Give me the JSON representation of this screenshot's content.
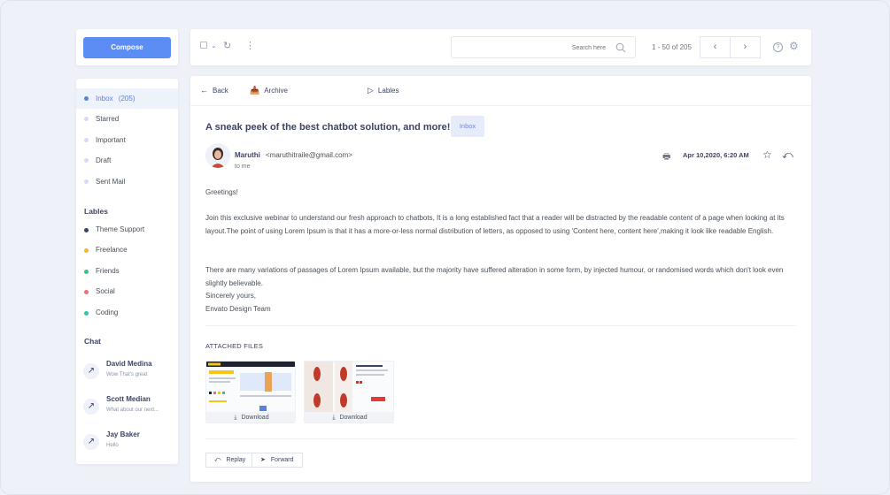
{
  "sidebar": {
    "compose_label": "Compose",
    "folders": [
      {
        "label": "Inbox",
        "count": "(205)",
        "color": "#5c7fd9"
      },
      {
        "label": "Starred",
        "color": "#d4dcf4"
      },
      {
        "label": "Important",
        "color": "#d4dcf4"
      },
      {
        "label": "Draft",
        "color": "#d4dcf4"
      },
      {
        "label": "Sent Mail",
        "color": "#d4dcf4"
      }
    ],
    "labels_title": "Lables",
    "labels": [
      {
        "label": "Theme Support",
        "color": "#3d4465"
      },
      {
        "label": "Freelance",
        "color": "#f5b724"
      },
      {
        "label": "Friends",
        "color": "#37c387"
      },
      {
        "label": "Social",
        "color": "#f06b7c"
      },
      {
        "label": "Coding",
        "color": "#2fc6a6"
      }
    ],
    "chat_title": "Chat",
    "chats": [
      {
        "name": "David Medina",
        "message": "Wow That's great"
      },
      {
        "name": "Scott Median",
        "message": "What about our next..."
      },
      {
        "name": "Jay Baker",
        "message": "Hello"
      }
    ]
  },
  "toolbar": {
    "search_placeholder": "Search here",
    "pager_text": "1 - 50 of 205",
    "icons": [
      "checkbox-icon",
      "chevron-down-icon",
      "refresh-icon",
      "more-vertical-icon",
      "search-icon",
      "chevron-left-icon",
      "chevron-right-icon",
      "help-icon",
      "gear-icon"
    ]
  },
  "email": {
    "actions": {
      "back": "Back",
      "archive": "Archive",
      "labels": "Lables"
    },
    "subject": "A sneak peek of the best chatbot solution, and more!",
    "badge": "Inbox",
    "sender_name": "Maruthi",
    "sender_email": "<maruthitraile@gmail.com>",
    "to": "to me",
    "date": "Apr 10,2020,  6:20 AM",
    "greeting": "Greetings!",
    "paragraph1": "Join this exclusive webinar to understand our fresh approach to chatbots, It is a long established fact that a reader will be distracted by the readable content of a page when looking at its layout.The point of using Lorem Ipsum is that it has a more-or-less normal distribution of letters, as opposed to using 'Content here, content here',making it look like readable English.",
    "paragraph2": "There are many variations of passages of Lorem Ipsum available, but the majority have suffered alteration in some form, by injected humour, or randomised words which don't look even slightly believable.",
    "signoff": "Sincerely yours,",
    "signature": "Envato Design Team",
    "attached_title": "ATTACHED FILES",
    "attachments": [
      {
        "download_label": "Download"
      },
      {
        "download_label": "Download"
      }
    ],
    "reply_label": "Replay",
    "forward_label": "Forward"
  },
  "colors": {
    "accent": "#5c8df5",
    "heading": "#3d4465",
    "background": "#eef1f7"
  }
}
